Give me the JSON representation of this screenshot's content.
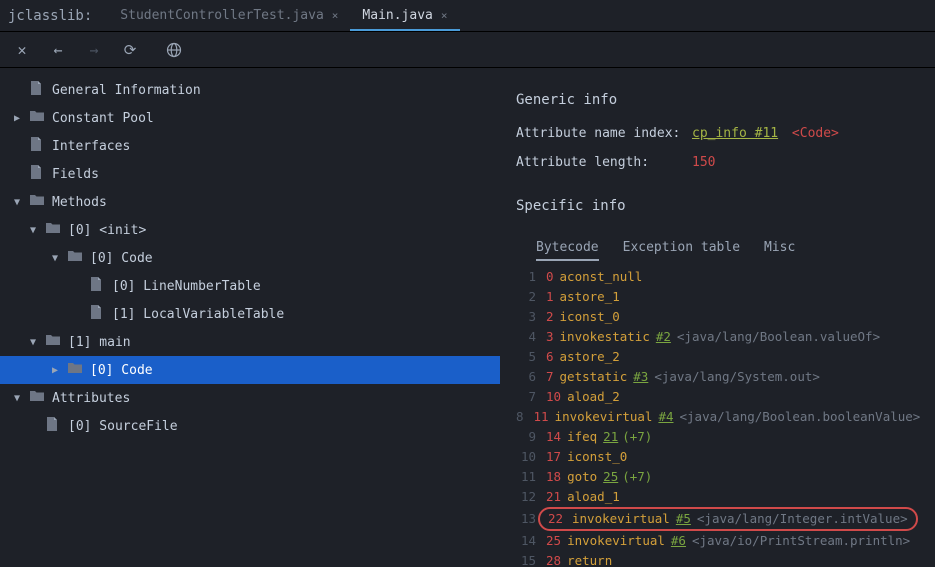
{
  "app": {
    "title": "jclasslib:"
  },
  "tabs": [
    {
      "label": "StudentControllerTest.java",
      "active": false
    },
    {
      "label": "Main.java",
      "active": true
    }
  ],
  "tree": [
    {
      "indent": 0,
      "arrow": "",
      "icon": "file",
      "label": "General Information"
    },
    {
      "indent": 0,
      "arrow": "▶",
      "icon": "folder",
      "label": "Constant Pool"
    },
    {
      "indent": 0,
      "arrow": "",
      "icon": "file",
      "label": "Interfaces"
    },
    {
      "indent": 0,
      "arrow": "",
      "icon": "file",
      "label": "Fields"
    },
    {
      "indent": 0,
      "arrow": "▼",
      "icon": "folder",
      "label": "Methods"
    },
    {
      "indent": 1,
      "arrow": "▼",
      "icon": "folder",
      "label": "[0] <init>"
    },
    {
      "indent": 2,
      "arrow": "▼",
      "icon": "folder",
      "label": "[0] Code"
    },
    {
      "indent": 3,
      "arrow": "",
      "icon": "file",
      "label": "[0] LineNumberTable"
    },
    {
      "indent": 3,
      "arrow": "",
      "icon": "file",
      "label": "[1] LocalVariableTable"
    },
    {
      "indent": 1,
      "arrow": "▼",
      "icon": "folder",
      "label": "[1] main"
    },
    {
      "indent": 2,
      "arrow": "▶",
      "icon": "folder",
      "label": "[0] Code",
      "selected": true
    },
    {
      "indent": 0,
      "arrow": "▼",
      "icon": "folder",
      "label": "Attributes"
    },
    {
      "indent": 1,
      "arrow": "",
      "icon": "file",
      "label": "[0] SourceFile"
    }
  ],
  "detail": {
    "generic_title": "Generic info",
    "attr_name_label": "Attribute name index:",
    "attr_name_link": "cp_info #11",
    "attr_name_tag": "<Code>",
    "attr_len_label": "Attribute length:",
    "attr_len_value": "150",
    "specific_title": "Specific info",
    "bc_tabs": [
      {
        "label": "Bytecode",
        "active": true
      },
      {
        "label": "Exception table",
        "active": false
      },
      {
        "label": "Misc",
        "active": false
      }
    ],
    "bytecode": [
      {
        "ln": "1",
        "off": "0",
        "op": "aconst_null"
      },
      {
        "ln": "2",
        "off": "1",
        "op": "astore_1"
      },
      {
        "ln": "3",
        "off": "2",
        "op": "iconst_0"
      },
      {
        "ln": "4",
        "off": "3",
        "op": "invokestatic",
        "ref": "#2",
        "comment": "<java/lang/Boolean.valueOf>"
      },
      {
        "ln": "5",
        "off": "6",
        "op": "astore_2"
      },
      {
        "ln": "6",
        "off": "7",
        "op": "getstatic",
        "ref": "#3",
        "comment": "<java/lang/System.out>"
      },
      {
        "ln": "7",
        "off": "10",
        "op": "aload_2"
      },
      {
        "ln": "8",
        "off": "11",
        "op": "invokevirtual",
        "ref": "#4",
        "comment": "<java/lang/Boolean.booleanValue>"
      },
      {
        "ln": "9",
        "off": "14",
        "op": "ifeq",
        "ref": "21",
        "delta": "(+7)"
      },
      {
        "ln": "10",
        "off": "17",
        "op": "iconst_0"
      },
      {
        "ln": "11",
        "off": "18",
        "op": "goto",
        "ref": "25",
        "delta": "(+7)"
      },
      {
        "ln": "12",
        "off": "21",
        "op": "aload_1"
      },
      {
        "ln": "13",
        "off": "22",
        "op": "invokevirtual",
        "ref": "#5",
        "comment": "<java/lang/Integer.intValue>",
        "highlight": true
      },
      {
        "ln": "14",
        "off": "25",
        "op": "invokevirtual",
        "ref": "#6",
        "comment": "<java/io/PrintStream.println>"
      },
      {
        "ln": "15",
        "off": "28",
        "op": "return"
      }
    ]
  }
}
